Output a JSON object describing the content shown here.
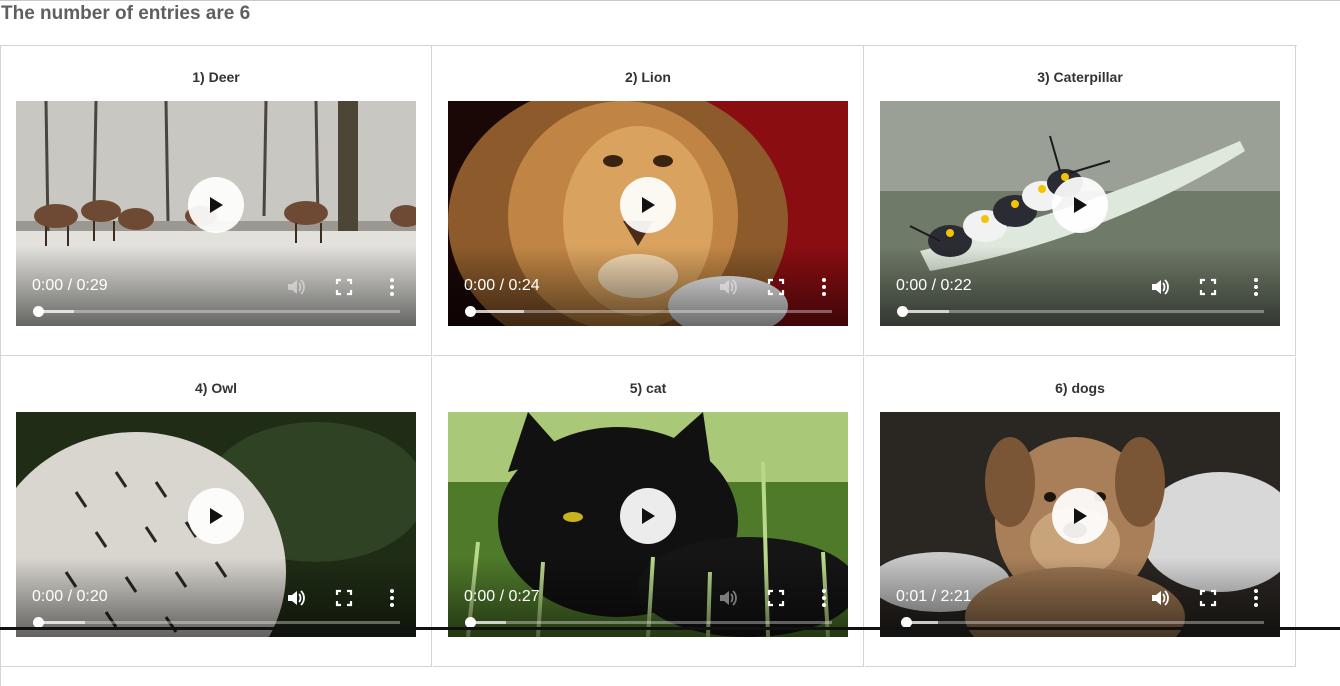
{
  "header": {
    "text": "The number of entries are 6"
  },
  "entries": [
    {
      "title": "1)  Deer",
      "time": "0:00 / 0:29",
      "progress": 0.0,
      "buffered": 0.1,
      "volume_active": false
    },
    {
      "title": "2)  Lion",
      "time": "0:00 / 0:24",
      "progress": 0.0,
      "buffered": 0.15,
      "volume_active": false
    },
    {
      "title": "3)  Caterpillar",
      "time": "0:00 / 0:22",
      "progress": 0.0,
      "buffered": 0.13,
      "volume_active": true
    },
    {
      "title": "4)  Owl",
      "time": "0:00 / 0:20",
      "progress": 0.0,
      "buffered": 0.13,
      "volume_active": true
    },
    {
      "title": "5)  cat",
      "time": "0:00 / 0:27",
      "progress": 0.0,
      "buffered": 0.1,
      "volume_active": false
    },
    {
      "title": "6)  dogs",
      "time": "0:01 / 2:21",
      "progress": 0.01,
      "buffered": 0.1,
      "volume_active": true
    }
  ],
  "colors": {
    "heading": "#5f5f5f",
    "grid_border": "#d5d5d5",
    "control_icon": "#ffffff"
  },
  "icons": {
    "play": "play-icon",
    "volume": "volume-icon",
    "fullscreen": "fullscreen-icon",
    "more": "more-vertical-icon"
  }
}
